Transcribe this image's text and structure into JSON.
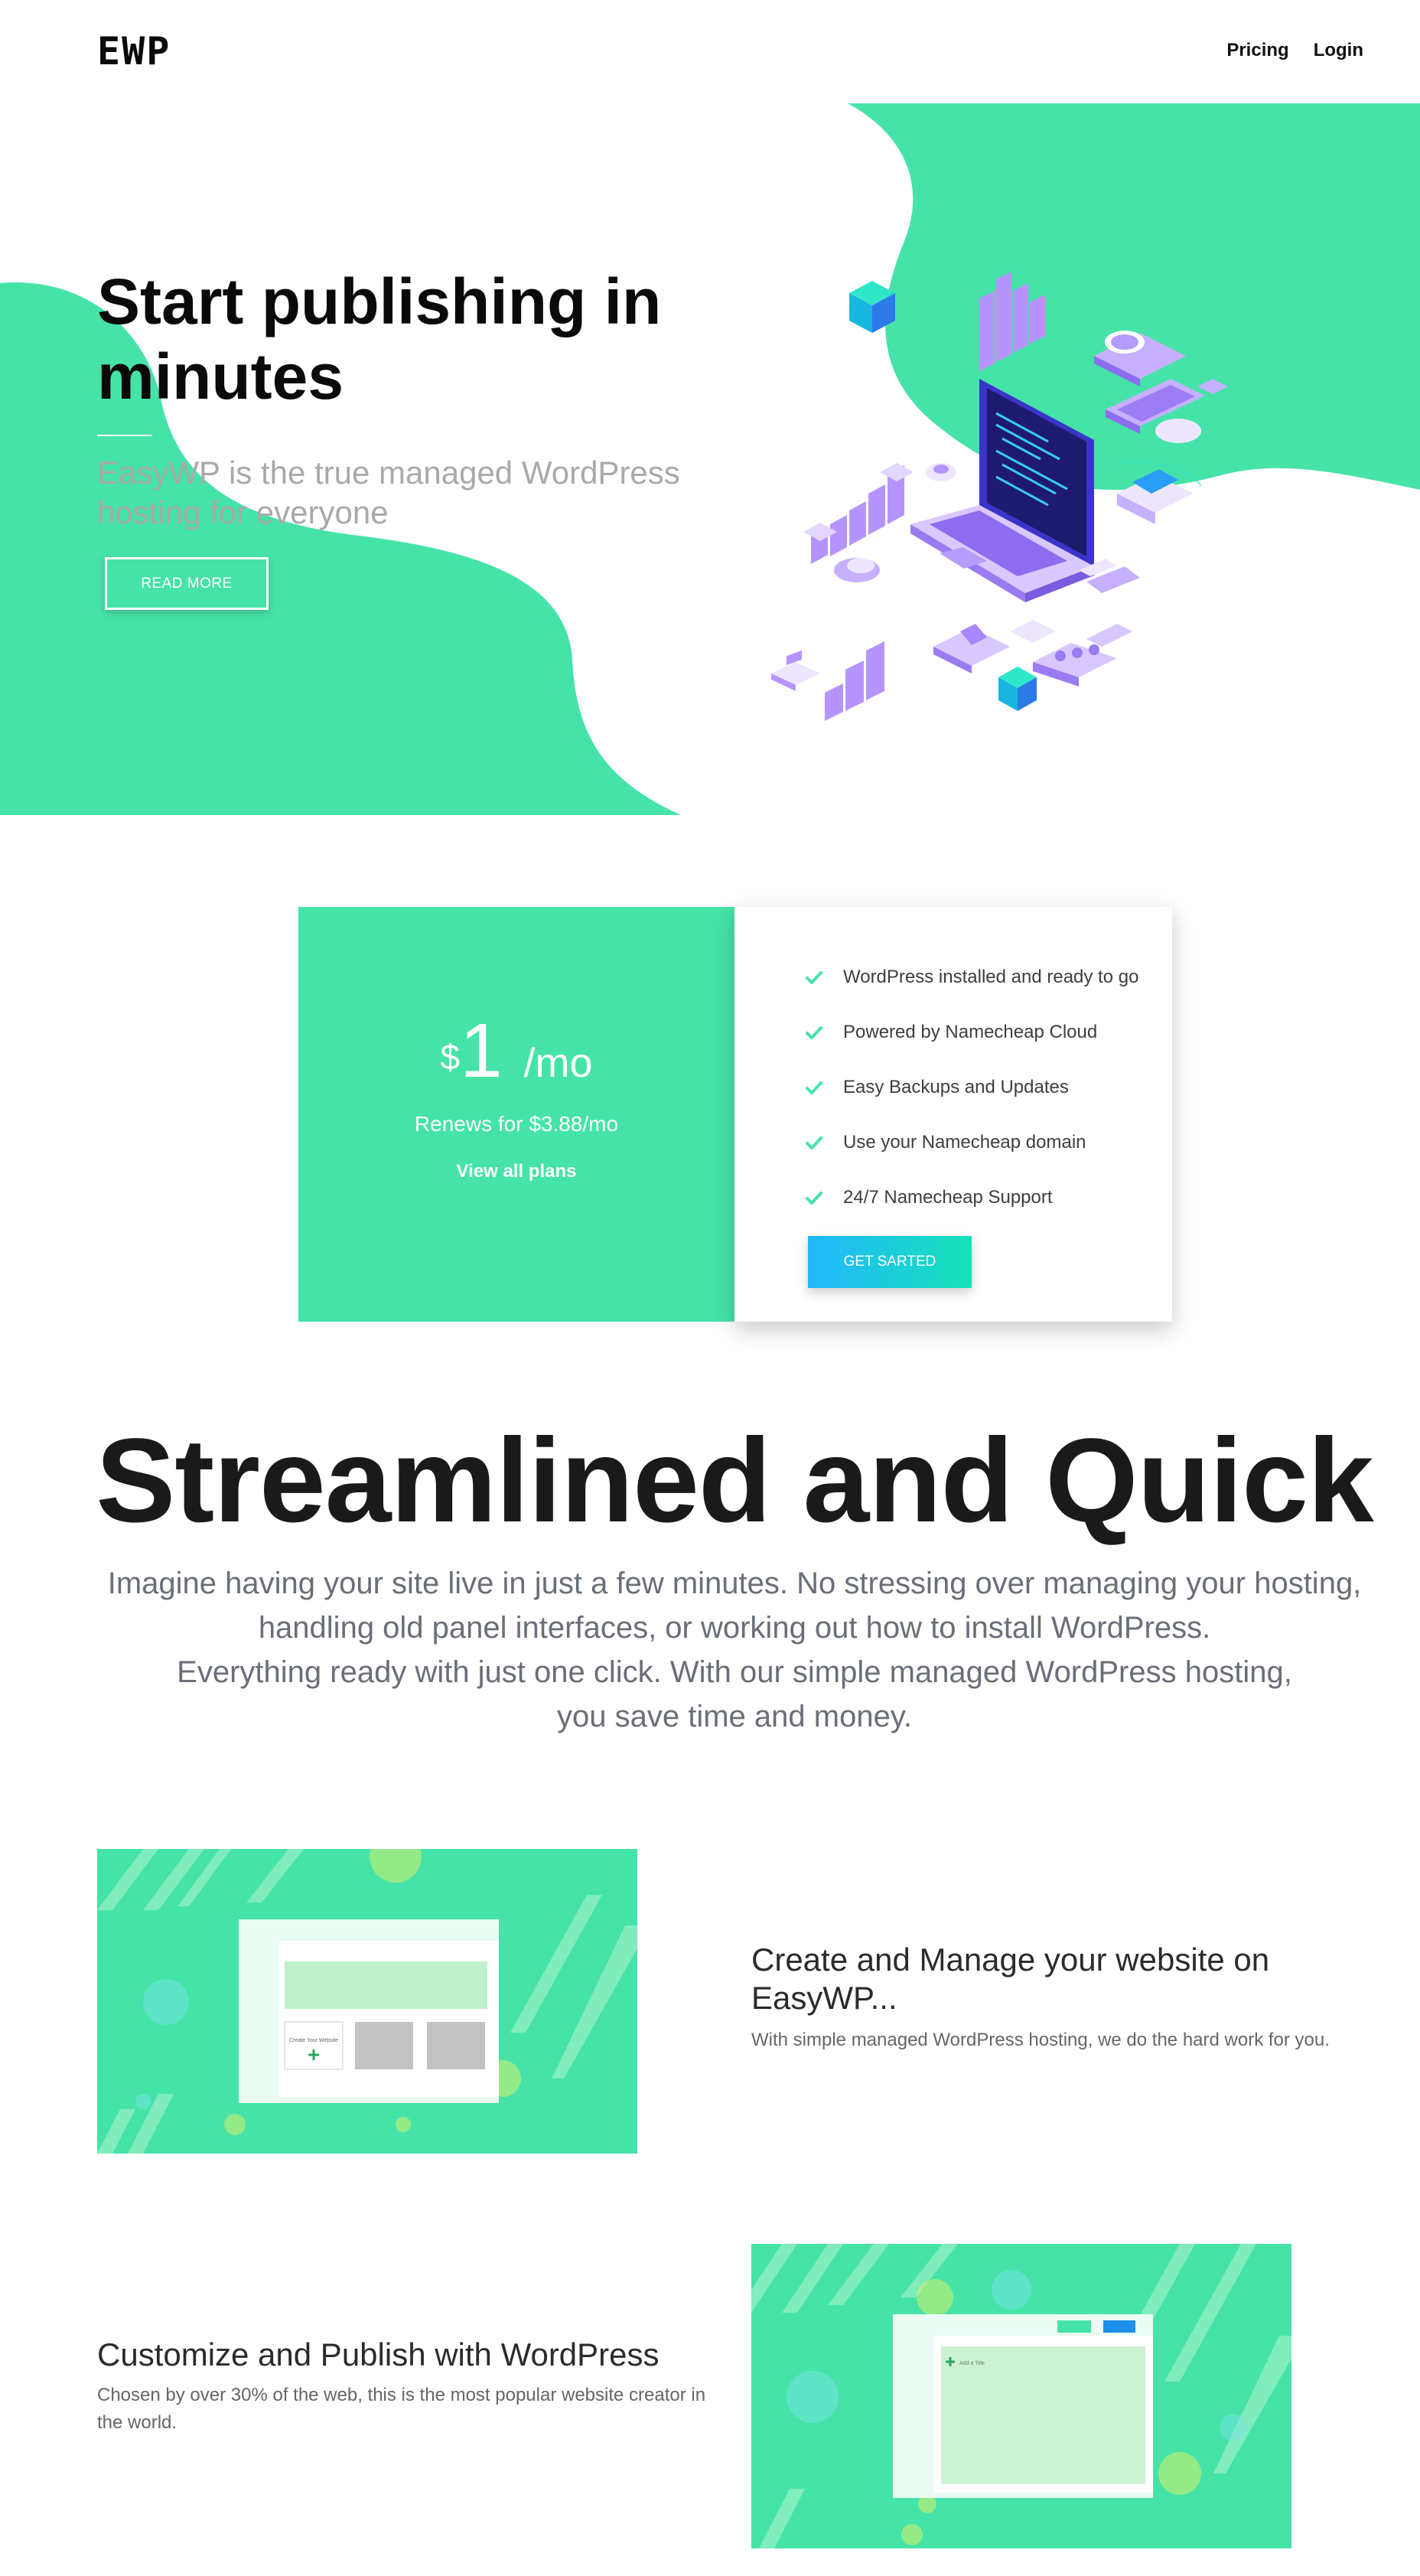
{
  "brand": {
    "logo": "EWP",
    "accent": "#46e3a8"
  },
  "nav": {
    "links": [
      "Pricing",
      "Login"
    ]
  },
  "hero": {
    "title": "Start publishing in minutes",
    "subtitle": "EasyWP is the true managed WordPress hosting for everyone",
    "cta": "READ MORE"
  },
  "pricing": {
    "currency": "$",
    "amount": "1",
    "period": "/mo",
    "renewal": "Renews for $3.88/mo",
    "link": "View all plans",
    "features": [
      "WordPress installed and ready to go",
      "Powered by Namecheap Cloud",
      "Easy Backups and Updates",
      "Use your Namecheap domain",
      "24/7 Namecheap Support"
    ],
    "cta": "GET SARTED"
  },
  "streamlined": {
    "title": "Streamlined and Quick",
    "lines": [
      "Imagine having your site live in just a few minutes. No stressing over managing your hosting,",
      "handling old panel interfaces, or working out how to install WordPress.",
      "Everything ready with just one click. With our simple managed WordPress hosting,",
      "you save time and money."
    ]
  },
  "rows": [
    {
      "title": "Create and Manage your website on EasyWP...",
      "text": "With simple managed WordPress hosting, we do the hard work for you.",
      "image_label": "Create Your Website"
    },
    {
      "title": "Customize and Publish with WordPress",
      "text": "Chosen by over 30% of the web, this is the most popular website creator in the world.",
      "image_label": "Add a Title"
    }
  ]
}
